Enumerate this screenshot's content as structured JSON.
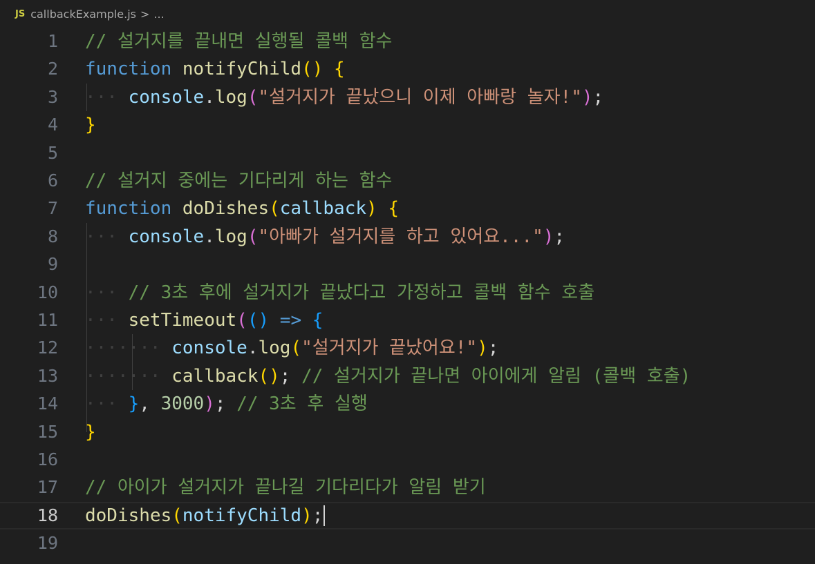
{
  "breadcrumb": {
    "icon": "JS",
    "file": "callbackExample.js",
    "sep": ">",
    "more": "..."
  },
  "editor": {
    "line_numbers": [
      "1",
      "2",
      "3",
      "4",
      "5",
      "6",
      "7",
      "8",
      "9",
      "10",
      "11",
      "12",
      "13",
      "14",
      "15",
      "16",
      "17",
      "18",
      "19"
    ],
    "active_line": "18",
    "lines": [
      [
        [
          "c",
          "// 설거지를 끝내면 실행될 콜백 함수"
        ]
      ],
      [
        [
          "kw",
          "function"
        ],
        [
          "pl",
          " "
        ],
        [
          "fn",
          "notifyChild"
        ],
        [
          "b1",
          "()"
        ],
        [
          "pl",
          " "
        ],
        [
          "b1",
          "{"
        ]
      ],
      [
        [
          "ws",
          "···"
        ],
        [
          "pl",
          " "
        ],
        [
          "var",
          "console"
        ],
        [
          "pl",
          "."
        ],
        [
          "fn",
          "log"
        ],
        [
          "b2",
          "("
        ],
        [
          "str",
          "\"설거지가 끝났으니 이제 아빠랑 놀자!\""
        ],
        [
          "b2",
          ")"
        ],
        [
          "pl",
          ";"
        ]
      ],
      [
        [
          "b1",
          "}"
        ]
      ],
      [],
      [
        [
          "c",
          "// 설거지 중에는 기다리게 하는 함수"
        ]
      ],
      [
        [
          "kw",
          "function"
        ],
        [
          "pl",
          " "
        ],
        [
          "fn",
          "doDishes"
        ],
        [
          "b1",
          "("
        ],
        [
          "var",
          "callback"
        ],
        [
          "b1",
          ")"
        ],
        [
          "pl",
          " "
        ],
        [
          "b1",
          "{"
        ]
      ],
      [
        [
          "ws",
          "···"
        ],
        [
          "pl",
          " "
        ],
        [
          "var",
          "console"
        ],
        [
          "pl",
          "."
        ],
        [
          "fn",
          "log"
        ],
        [
          "b2",
          "("
        ],
        [
          "str",
          "\"아빠가 설거지를 하고 있어요...\""
        ],
        [
          "b2",
          ")"
        ],
        [
          "pl",
          ";"
        ]
      ],
      [],
      [
        [
          "ws",
          "···"
        ],
        [
          "pl",
          " "
        ],
        [
          "c",
          "// 3초 후에 설거지가 끝났다고 가정하고 콜백 함수 호출"
        ]
      ],
      [
        [
          "ws",
          "···"
        ],
        [
          "pl",
          " "
        ],
        [
          "fn",
          "setTimeout"
        ],
        [
          "b2",
          "("
        ],
        [
          "b3",
          "()"
        ],
        [
          "pl",
          " "
        ],
        [
          "op",
          "=>"
        ],
        [
          "pl",
          " "
        ],
        [
          "b3",
          "{"
        ]
      ],
      [
        [
          "ws",
          "·······"
        ],
        [
          "pl",
          " "
        ],
        [
          "var",
          "console"
        ],
        [
          "pl",
          "."
        ],
        [
          "fn",
          "log"
        ],
        [
          "b1",
          "("
        ],
        [
          "str",
          "\"설거지가 끝났어요!\""
        ],
        [
          "b1",
          ")"
        ],
        [
          "pl",
          ";"
        ]
      ],
      [
        [
          "ws",
          "·······"
        ],
        [
          "pl",
          " "
        ],
        [
          "fn",
          "callback"
        ],
        [
          "b1",
          "()"
        ],
        [
          "pl",
          "; "
        ],
        [
          "c",
          "// 설거지가 끝나면 아이에게 알림 (콜백 호출)"
        ]
      ],
      [
        [
          "ws",
          "···"
        ],
        [
          "pl",
          " "
        ],
        [
          "b3",
          "}"
        ],
        [
          "pl",
          ", "
        ],
        [
          "num",
          "3000"
        ],
        [
          "b2",
          ")"
        ],
        [
          "pl",
          "; "
        ],
        [
          "c",
          "// 3초 후 실행"
        ]
      ],
      [
        [
          "b1",
          "}"
        ]
      ],
      [],
      [
        [
          "c",
          "// 아이가 설거지가 끝나길 기다리다가 알림 받기"
        ]
      ],
      [
        [
          "fn",
          "doDishes"
        ],
        [
          "b1",
          "("
        ],
        [
          "var",
          "notifyChild"
        ],
        [
          "b1",
          ")"
        ],
        [
          "pl",
          ";"
        ]
      ],
      []
    ]
  }
}
